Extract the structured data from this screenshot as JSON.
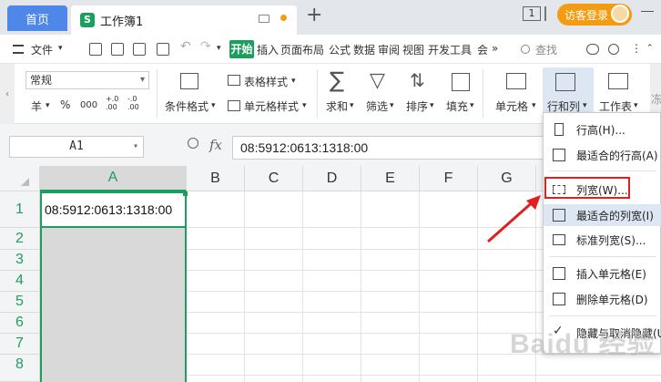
{
  "titlebar": {
    "home_tab": "首页",
    "doc_icon": "S",
    "doc_title": "工作簿1",
    "plus": "+",
    "num_badge": "1",
    "login_label": "访客登录",
    "accent": "#4f87e8",
    "login_color": "#f39c12"
  },
  "menubar": {
    "file_label": "文件",
    "start": "开始",
    "items": [
      "插入",
      "页面布局",
      "公式",
      "数据",
      "审阅",
      "视图",
      "开发工具",
      "会"
    ],
    "more": "»",
    "search": "查找",
    "brand": "#1e9e5e"
  },
  "ribbon": {
    "style_value": "常规",
    "num_symbols": [
      "羊",
      "%",
      "000",
      "+.0 .00",
      "-.0 .00"
    ],
    "cond_format": "条件格式",
    "table_style": "表格样式",
    "cell_style": "单元格样式",
    "sum": "求和",
    "filter": "筛选",
    "sort": "排序",
    "fill": "填充",
    "cell": "单元格",
    "rowcol": "行和列",
    "sheet": "工作表",
    "more": "冻"
  },
  "formulabar": {
    "namebox": "A1",
    "fx": "fx",
    "formula": "08:5912:0613:1318:00"
  },
  "sheet": {
    "columns": [
      "A",
      "B",
      "C",
      "D",
      "E",
      "F",
      "G"
    ],
    "rows": [
      "1",
      "2",
      "3",
      "4",
      "5",
      "6",
      "7",
      "8"
    ],
    "a1_value": "08:5912:0613:1318:00"
  },
  "dropdown": {
    "items": [
      "行高(H)...",
      "最适合的行高(A)",
      "列宽(W)...",
      "最适合的列宽(I)",
      "标准列宽(S)...",
      "插入单元格(E)",
      "删除单元格(D)",
      "隐藏与取消隐藏(U)"
    ],
    "highlight_color": "#e02020"
  },
  "watermark": "Baidu 经验"
}
